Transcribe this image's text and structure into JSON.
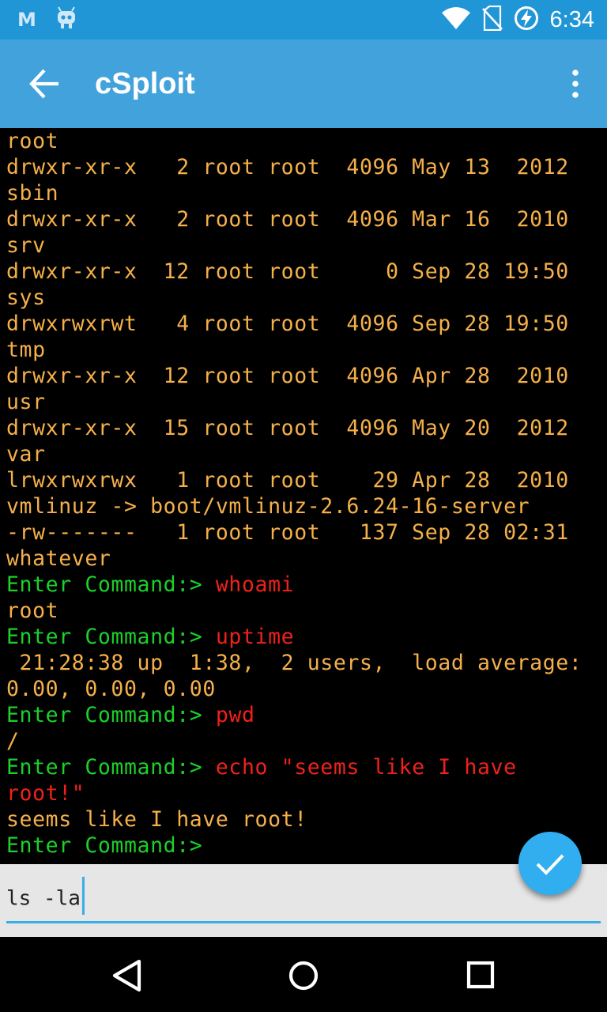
{
  "status_bar": {
    "time": "6:34",
    "left_icons": [
      "gmail-icon",
      "cyanogen-bot-icon"
    ],
    "right_icons": [
      "wifi-icon",
      "no-sim-icon",
      "battery-charging-icon"
    ],
    "m_glyph": "M"
  },
  "app_bar": {
    "title": "cSploit",
    "background": "#42a2dc"
  },
  "terminal": {
    "lines": [
      {
        "type": "out",
        "text": "root"
      },
      {
        "type": "out",
        "text": "drwxr-xr-x   2 root root  4096 May 13  2012"
      },
      {
        "type": "out",
        "text": "sbin"
      },
      {
        "type": "out",
        "text": "drwxr-xr-x   2 root root  4096 Mar 16  2010"
      },
      {
        "type": "out",
        "text": "srv"
      },
      {
        "type": "out",
        "text": "drwxr-xr-x  12 root root     0 Sep 28 19:50"
      },
      {
        "type": "out",
        "text": "sys"
      },
      {
        "type": "out",
        "text": "drwxrwxrwt   4 root root  4096 Sep 28 19:50"
      },
      {
        "type": "out",
        "text": "tmp"
      },
      {
        "type": "out",
        "text": "drwxr-xr-x  12 root root  4096 Apr 28  2010"
      },
      {
        "type": "out",
        "text": "usr"
      },
      {
        "type": "out",
        "text": "drwxr-xr-x  15 root root  4096 May 20  2012"
      },
      {
        "type": "out",
        "text": "var"
      },
      {
        "type": "out",
        "text": "lrwxrwxrwx   1 root root    29 Apr 28  2010"
      },
      {
        "type": "out",
        "text": "vmlinuz -> boot/vmlinuz-2.6.24-16-server"
      },
      {
        "type": "out",
        "text": "-rw-------   1 root root   137 Sep 28 02:31"
      },
      {
        "type": "out",
        "text": "whatever"
      },
      {
        "type": "cmd",
        "prompt": "Enter Command:> ",
        "text": "whoami"
      },
      {
        "type": "out",
        "text": "root"
      },
      {
        "type": "cmd",
        "prompt": "Enter Command:> ",
        "text": "uptime"
      },
      {
        "type": "out",
        "text": " 21:28:38 up  1:38,  2 users,  load average:"
      },
      {
        "type": "out",
        "text": "0.00, 0.00, 0.00"
      },
      {
        "type": "cmd",
        "prompt": "Enter Command:> ",
        "text": "pwd"
      },
      {
        "type": "out",
        "text": "/"
      },
      {
        "type": "cmd",
        "prompt": "Enter Command:> ",
        "text": "echo \"seems like I have"
      },
      {
        "type": "cmdcont",
        "text": "root!\""
      },
      {
        "type": "out",
        "text": "seems like I have root!"
      },
      {
        "type": "cmd",
        "prompt": "Enter Command:> ",
        "text": ""
      }
    ],
    "colors": {
      "output": "#f5b04a",
      "prompt": "#1bd12a",
      "command": "#f0211b"
    }
  },
  "input": {
    "value": "ls -la"
  },
  "fab": {
    "icon": "check-icon"
  },
  "nav_bar": {
    "icons": [
      "back-triangle-icon",
      "home-circle-icon",
      "recents-square-icon"
    ]
  }
}
